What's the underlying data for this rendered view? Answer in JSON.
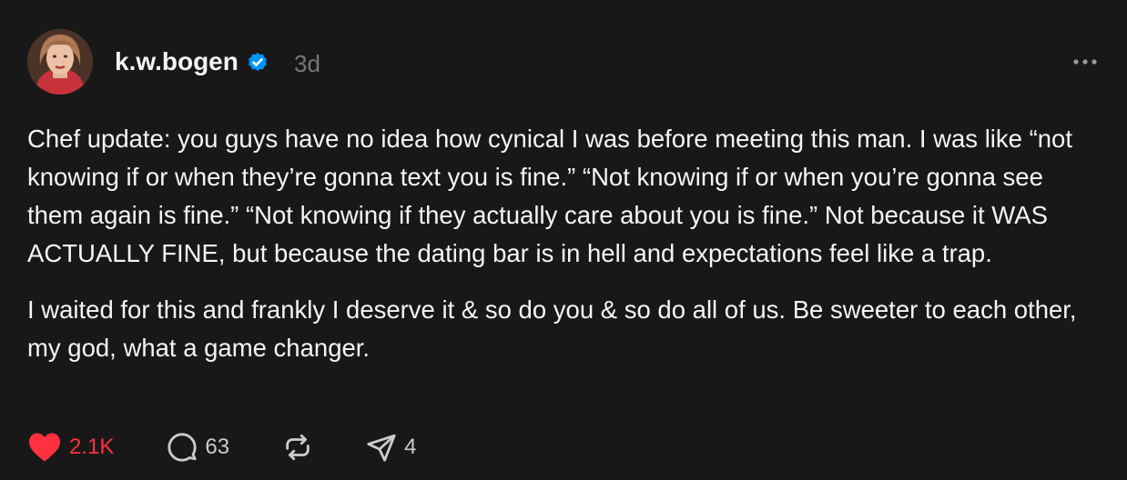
{
  "post": {
    "author": "k.w.bogen",
    "time": "3d",
    "paragraphs": [
      "Chef update: you guys have no idea how cynical I was before meeting this man. I was like “not knowing if or when they’re gonna text you is fine.” “Not knowing if or when you’re gonna see them again is fine.” “Not knowing if they actually care about you is fine.” Not because it WAS ACTUALLY FINE, but because the dating bar is in hell and expectations feel like a trap.",
      "I waited for this and frankly I deserve it & so do you & so do all of us. Be sweeter to each other, my god, what a game changer."
    ]
  },
  "actions": {
    "likes": "2.1K",
    "replies": "63",
    "shares": "4"
  },
  "icons": {
    "verified": "verified-badge-icon",
    "more": "more-options-icon",
    "like": "heart-icon",
    "reply": "comment-icon",
    "repost": "repost-icon",
    "share": "send-icon"
  },
  "colors": {
    "background": "#181818",
    "text": "#f3f5f7",
    "muted": "#777777",
    "like": "#ff3040",
    "verified": "#0095f6"
  }
}
